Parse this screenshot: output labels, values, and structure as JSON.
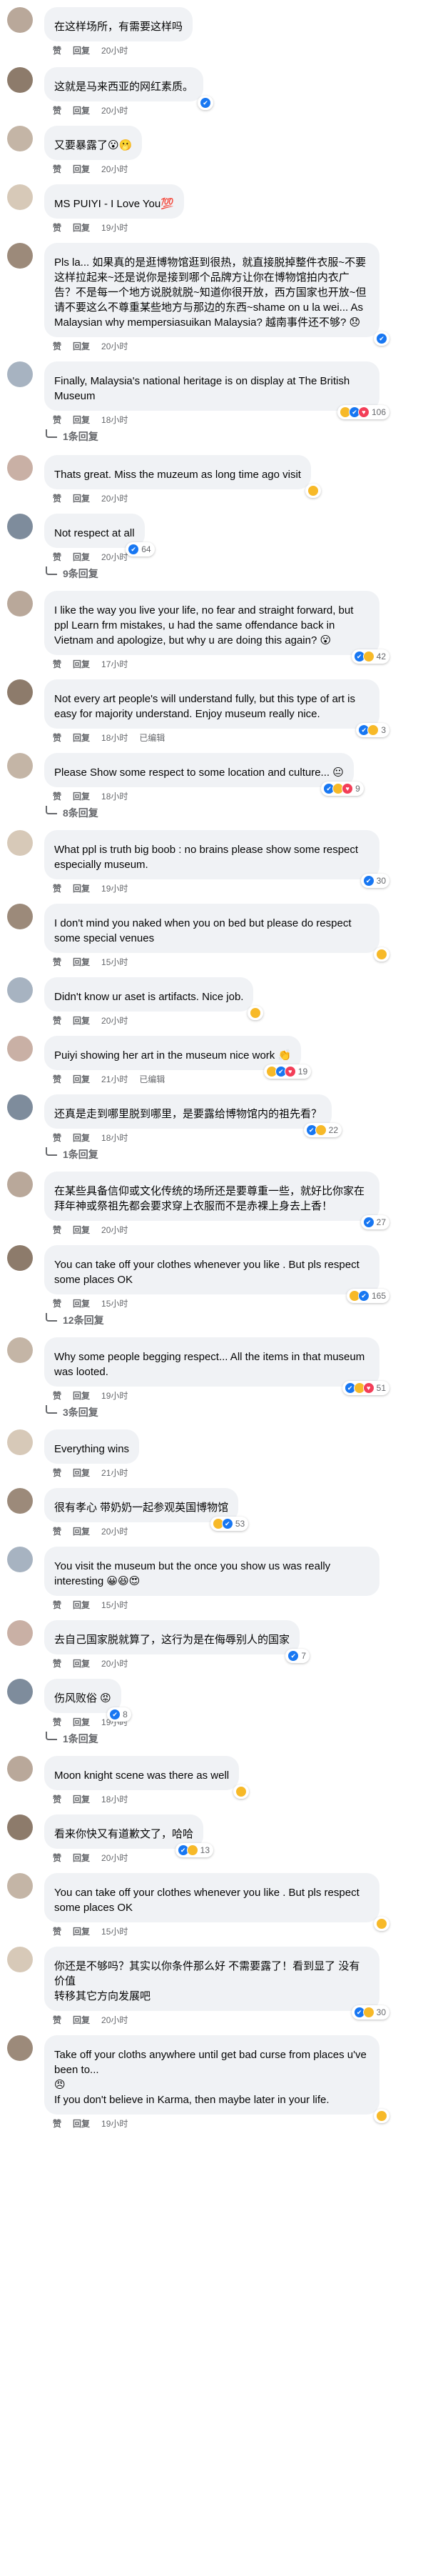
{
  "labels": {
    "like": "赞",
    "reply": "回复"
  },
  "colors": {
    "bubble_bg": "#f0f2f5",
    "meta_text": "#65676b",
    "like_blue": "#1877f2",
    "haha_yellow": "#f7b928",
    "love_red": "#f33e58"
  },
  "comments": [
    {
      "text": "在这样场所，有需要这样吗",
      "time": "20小时",
      "reactions": [],
      "count": "",
      "replies": ""
    },
    {
      "text": "这就是马来西亚的网红素质。",
      "time": "20小时",
      "reactions": [
        "like"
      ],
      "count": "",
      "replies": ""
    },
    {
      "text": "又要暴露了😮🫢",
      "time": "20小时",
      "reactions": [],
      "count": "",
      "replies": ""
    },
    {
      "text": "MS PUIYI - I Love You💯",
      "time": "19小时",
      "reactions": [],
      "count": "",
      "replies": ""
    },
    {
      "text": "Pls la... 如果真的是逛博物馆逛到很热，就直接脱掉整件衣服~不要这样拉起来~还是说你是接到哪个品牌方让你在博物馆拍内衣广告？不是每一个地方说脱就脱~知道你很开放，西方国家也开放~但请不要这么不尊重某些地方与那边的东西~shame on u la wei... As Malaysian why mempersiasuikan Malaysia? 越南事件还不够? 😞",
      "time": "20小时",
      "reactions": [
        "like"
      ],
      "count": "",
      "replies": ""
    },
    {
      "text": "Finally, Malaysia's national heritage is on display at The British Museum",
      "time": "18小时",
      "reactions": [
        "haha",
        "like",
        "love"
      ],
      "count": "106",
      "replies": "1条回复"
    },
    {
      "text": "Thats great. Miss the muzeum as long time ago visit",
      "time": "20小时",
      "reactions": [
        "haha"
      ],
      "count": "",
      "replies": ""
    },
    {
      "text": "Not respect at all",
      "time": "20小时",
      "reactions": [
        "like"
      ],
      "count": "64",
      "replies": "9条回复"
    },
    {
      "text": "I like the way you live your life, no fear and straight forward, but ppl Learn frm mistakes, u had the same offendance back in Vietnam and apologize, but why u are doing this again? 😮",
      "time": "17小时",
      "reactions": [
        "like",
        "haha"
      ],
      "count": "42",
      "replies": ""
    },
    {
      "text": "Not every art people's will understand fully, but this type of art is easy for majority understand. Enjoy museum really nice.",
      "time": "18小时",
      "edited": "已编辑",
      "reactions": [
        "like",
        "haha"
      ],
      "count": "3",
      "replies": ""
    },
    {
      "text": "Please Show some respect to some location and culture... 😐",
      "time": "18小时",
      "reactions": [
        "like",
        "haha",
        "love"
      ],
      "count": "9",
      "replies": "8条回复"
    },
    {
      "text": "What ppl is truth big boob : no brains please show some respect especially museum.",
      "time": "19小时",
      "reactions": [
        "like"
      ],
      "count": "30",
      "replies": ""
    },
    {
      "text": "I don't mind you naked when you on bed but please do respect some special venues",
      "time": "15小时",
      "reactions": [
        "haha"
      ],
      "count": "",
      "replies": ""
    },
    {
      "text": "Didn't know ur aset is artifacts. Nice job.",
      "time": "20小时",
      "reactions": [
        "haha"
      ],
      "count": "",
      "replies": ""
    },
    {
      "text": "Puiyi showing her art in the museum nice work 👏",
      "time": "21小时",
      "edited": "已编辑",
      "reactions": [
        "haha",
        "like",
        "love"
      ],
      "count": "19",
      "replies": ""
    },
    {
      "text": "还真是走到哪里脱到哪里，是要露给博物馆内的祖先看？",
      "time": "18小时",
      "reactions": [
        "like",
        "haha"
      ],
      "count": "22",
      "replies": "1条回复"
    },
    {
      "text": "在某些具备信仰或文化传统的场所还是要尊重一些，就好比你家在拜年神或祭祖先都会要求穿上衣服而不是赤裸上身去上香！",
      "time": "20小时",
      "reactions": [
        "like"
      ],
      "count": "27",
      "replies": ""
    },
    {
      "text": "You can take off your clothes whenever you like . But pls respect some places OK",
      "time": "15小时",
      "reactions": [
        "haha",
        "like"
      ],
      "count": "165",
      "replies": "12条回复"
    },
    {
      "text": "Why some people begging respect... All the items in that museum was looted.",
      "time": "19小时",
      "reactions": [
        "like",
        "haha",
        "love"
      ],
      "count": "51",
      "replies": "3条回复"
    },
    {
      "text": "Everything wins",
      "time": "21小时",
      "reactions": [],
      "count": "",
      "replies": ""
    },
    {
      "text": "很有孝心 带奶奶一起参观英国博物馆",
      "time": "20小时",
      "reactions": [
        "haha",
        "like"
      ],
      "count": "53",
      "replies": ""
    },
    {
      "text": "You visit the museum but the once you show us was really interesting 😀😆😍",
      "time": "15小时",
      "reactions": [],
      "count": "",
      "replies": ""
    },
    {
      "text": "去自己国家脱就算了，这行为是在侮辱别人的国家",
      "time": "20小时",
      "reactions": [
        "like"
      ],
      "count": "7",
      "replies": ""
    },
    {
      "text": "伤风败俗 😡",
      "time": "19小时",
      "reactions": [
        "like"
      ],
      "count": "8",
      "replies": "1条回复"
    },
    {
      "text": "Moon knight scene was there as well",
      "time": "18小时",
      "reactions": [
        "haha"
      ],
      "count": "",
      "replies": ""
    },
    {
      "text": "看来你快又有道歉文了，哈哈",
      "time": "20小时",
      "reactions": [
        "like",
        "haha"
      ],
      "count": "13",
      "replies": ""
    },
    {
      "text": "You can take off your clothes whenever you like . But pls respect some places OK",
      "time": "15小时",
      "reactions": [
        "haha"
      ],
      "count": "",
      "replies": ""
    },
    {
      "text": "你还是不够吗？其实以你条件那么好 不需要露了！看到显了 没有价值\n转移其它方向发展吧",
      "time": "20小时",
      "reactions": [
        "like",
        "haha"
      ],
      "count": "30",
      "replies": ""
    },
    {
      "text": "Take off your cloths anywhere until get bad curse from places u've been to...\n😠\nIf you don't believe in Karma, then maybe later in your life.",
      "time": "19小时",
      "reactions": [
        "haha"
      ],
      "count": "",
      "replies": ""
    }
  ]
}
